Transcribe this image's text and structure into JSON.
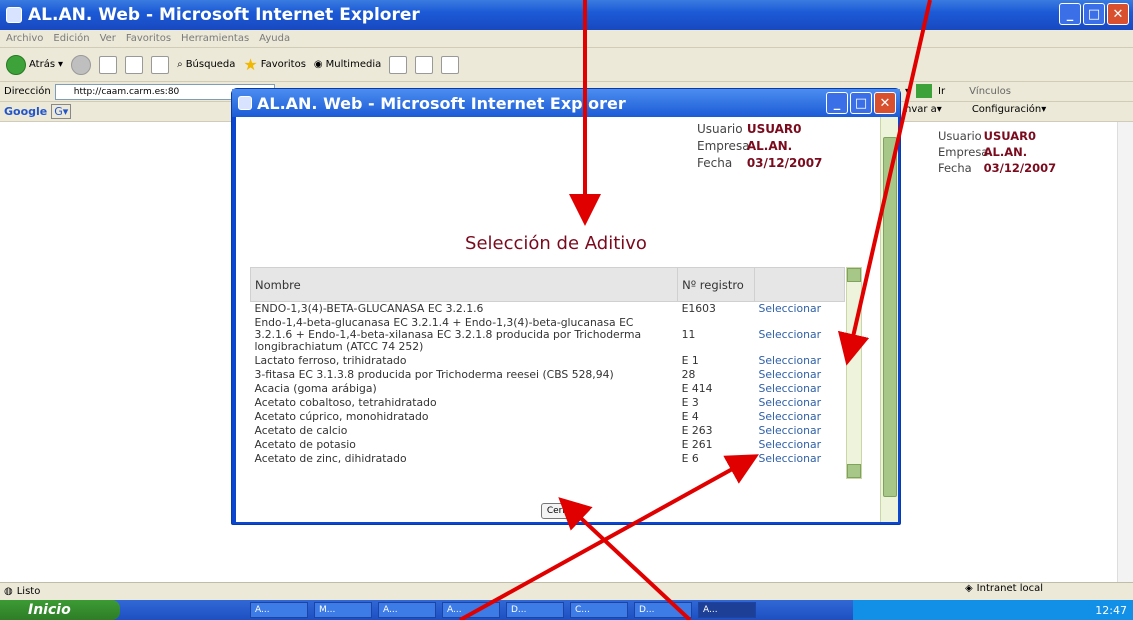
{
  "browser": {
    "title": "AL.AN. Web - Microsoft Internet Explorer",
    "menu": [
      "Archivo",
      "Edición",
      "Ver",
      "Favoritos",
      "Herramientas",
      "Ayuda"
    ],
    "toolbar": {
      "back": "Atrás",
      "search": "Búsqueda",
      "favorites": "Favoritos",
      "media": "Multimedia"
    },
    "address_label": "Dirección",
    "address_value": "http://caam.carm.es:80",
    "go_label": "Ir",
    "links_label": "Vínculos",
    "google": "Google",
    "google_right": [
      "nvar a▾",
      "Configuración▾"
    ]
  },
  "bg_user": {
    "usuario_label": "Usuario",
    "usuario": "USUAR0",
    "empresa_label": "Empresa",
    "empresa": "AL.AN.",
    "fecha_label": "Fecha",
    "fecha": "03/12/2007"
  },
  "popup": {
    "title": "AL.AN. Web - Microsoft Internet Explorer",
    "usuario_label": "Usuario",
    "usuario": "USUAR0",
    "empresa_label": "Empresa",
    "empresa": "AL.AN.",
    "fecha_label": "Fecha",
    "fecha": "03/12/2007",
    "heading": "Selección de Aditivo",
    "col_nombre": "Nombre",
    "col_registro": "Nº registro",
    "rows": [
      {
        "nombre": "ENDO-1,3(4)-BETA-GLUCANASA EC 3.2.1.6",
        "registro": "E1603",
        "accion": "Seleccionar"
      },
      {
        "nombre": "Endo-1,4-beta-glucanasa EC 3.2.1.4 + Endo-1,3(4)-beta-glucanasa EC 3.2.1.6 + Endo-1,4-beta-xilanasa EC 3.2.1.8 producida por Trichoderma longibrachiatum (ATCC 74 252)",
        "registro": "11",
        "accion": "Seleccionar"
      },
      {
        "nombre": "Lactato ferroso, trihidratado",
        "registro": "E 1",
        "accion": "Seleccionar"
      },
      {
        "nombre": "3-fitasa EC 3.1.3.8 producida por Trichoderma reesei (CBS 528,94)",
        "registro": "28",
        "accion": "Seleccionar"
      },
      {
        "nombre": "Acacia (goma arábiga)",
        "registro": "E 414",
        "accion": "Seleccionar"
      },
      {
        "nombre": "Acetato cobaltoso, tetrahidratado",
        "registro": "E 3",
        "accion": "Seleccionar"
      },
      {
        "nombre": "Acetato cúprico, monohidratado",
        "registro": "E 4",
        "accion": "Seleccionar"
      },
      {
        "nombre": "Acetato de calcio",
        "registro": "E 263",
        "accion": "Seleccionar"
      },
      {
        "nombre": "Acetato de potasio",
        "registro": "E 261",
        "accion": "Seleccionar"
      },
      {
        "nombre": "Acetato de zinc, dihidratado",
        "registro": "E 6",
        "accion": "Seleccionar"
      }
    ],
    "close_label": "Cerrar"
  },
  "status": {
    "text": "Listo",
    "zone": "Intranet local"
  },
  "taskbar": {
    "start": "Inicio",
    "tasks": [
      "A...",
      "M...",
      "A...",
      "A...",
      "D...",
      "C...",
      "D...",
      "A..."
    ],
    "clock": "12:47"
  },
  "colors": {
    "accent_red": "#e00000",
    "title_blue": "#0a46cf",
    "maroon": "#7a0b1e",
    "link": "#2e5fa8"
  }
}
